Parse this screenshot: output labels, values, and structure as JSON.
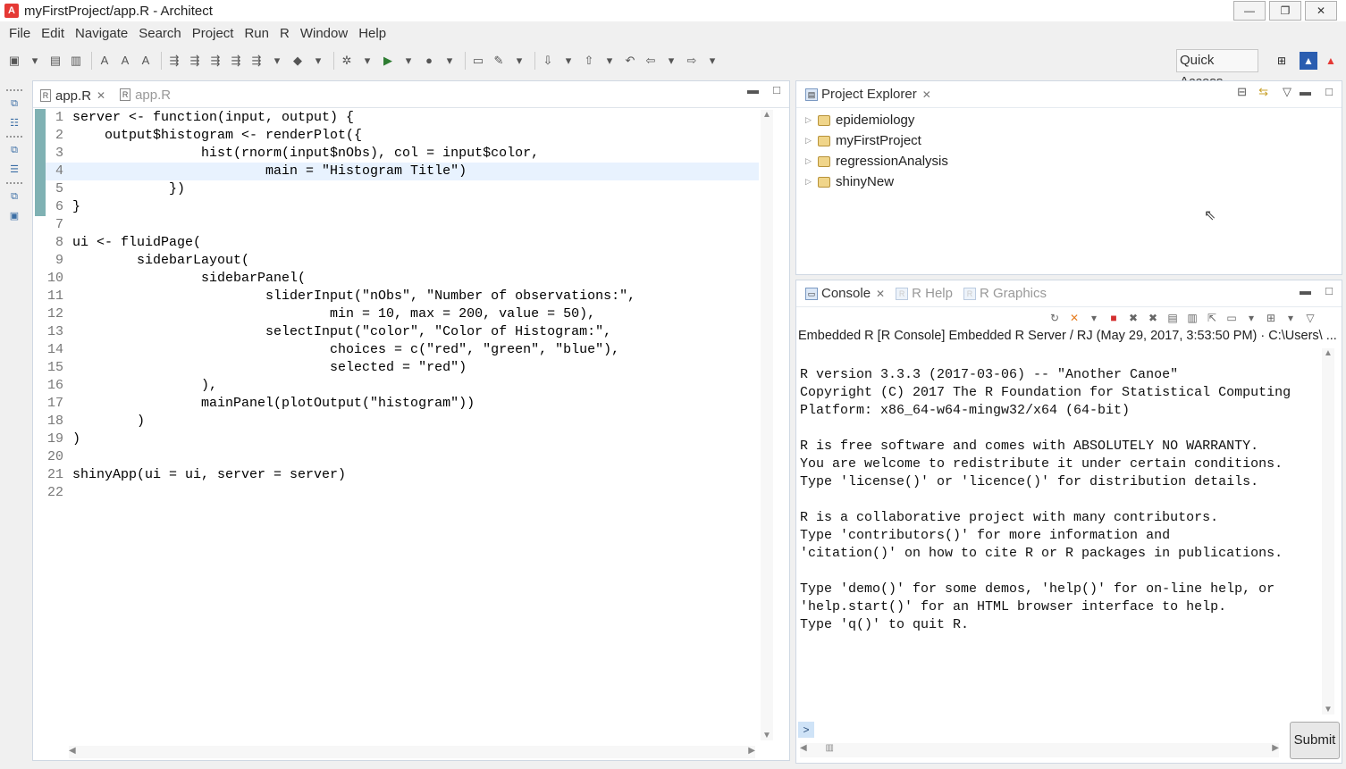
{
  "window": {
    "title": "myFirstProject/app.R - Architect",
    "logo": "A",
    "controls": {
      "minimize": "—",
      "maximize": "❐",
      "close": "✕"
    }
  },
  "menu": [
    "File",
    "Edit",
    "Navigate",
    "Search",
    "Project",
    "Run",
    "R",
    "Window",
    "Help"
  ],
  "toolbar": {
    "quick_access": "Quick Access"
  },
  "editor": {
    "tabs": [
      {
        "label": "app.R",
        "active": true
      },
      {
        "label": "app.R",
        "active": false
      }
    ],
    "lines": [
      {
        "n": "1",
        "text": "server <- function(input, output) {"
      },
      {
        "n": "2",
        "text": "    output$histogram <- renderPlot({"
      },
      {
        "n": "3",
        "text": "                hist(rnorm(input$nObs), col = input$color,"
      },
      {
        "n": "4",
        "text": "                        main = \"Histogram Title\")"
      },
      {
        "n": "5",
        "text": "            })"
      },
      {
        "n": "6",
        "text": "}"
      },
      {
        "n": "7",
        "text": ""
      },
      {
        "n": "8",
        "text": "ui <- fluidPage("
      },
      {
        "n": "9",
        "text": "        sidebarLayout("
      },
      {
        "n": "10",
        "text": "                sidebarPanel("
      },
      {
        "n": "11",
        "text": "                        sliderInput(\"nObs\", \"Number of observations:\","
      },
      {
        "n": "12",
        "text": "                                min = 10, max = 200, value = 50),"
      },
      {
        "n": "13",
        "text": "                        selectInput(\"color\", \"Color of Histogram:\","
      },
      {
        "n": "14",
        "text": "                                choices = c(\"red\", \"green\", \"blue\"),"
      },
      {
        "n": "15",
        "text": "                                selected = \"red\")"
      },
      {
        "n": "16",
        "text": "                ),"
      },
      {
        "n": "17",
        "text": "                mainPanel(plotOutput(\"histogram\"))"
      },
      {
        "n": "18",
        "text": "        )"
      },
      {
        "n": "19",
        "text": ")"
      },
      {
        "n": "20",
        "text": ""
      },
      {
        "n": "21",
        "text": "shinyApp(ui = ui, server = server)"
      },
      {
        "n": "22",
        "text": ""
      }
    ]
  },
  "project_explorer": {
    "title": "Project Explorer",
    "items": [
      "epidemiology",
      "myFirstProject",
      "regressionAnalysis",
      "shinyNew"
    ]
  },
  "console": {
    "tabs": [
      "Console",
      "R Help",
      "R Graphics"
    ],
    "description": "Embedded R [R Console] Embedded R Server / RJ (May 29, 2017, 3:53:50 PM)  ·  C:\\Users\\ ... \\",
    "output": "R version 3.3.3 (2017-03-06) -- \"Another Canoe\"\nCopyright (C) 2017 The R Foundation for Statistical Computing\nPlatform: x86_64-w64-mingw32/x64 (64-bit)\n\nR is free software and comes with ABSOLUTELY NO WARRANTY.\nYou are welcome to redistribute it under certain conditions.\nType 'license()' or 'licence()' for distribution details.\n\nR is a collaborative project with many contributors.\nType 'contributors()' for more information and\n'citation()' on how to cite R or R packages in publications.\n\nType 'demo()' for some demos, 'help()' for on-line help, or\n'help.start()' for an HTML browser interface to help.\nType 'q()' to quit R.",
    "prompt": ">",
    "submit_label": "Submit"
  }
}
